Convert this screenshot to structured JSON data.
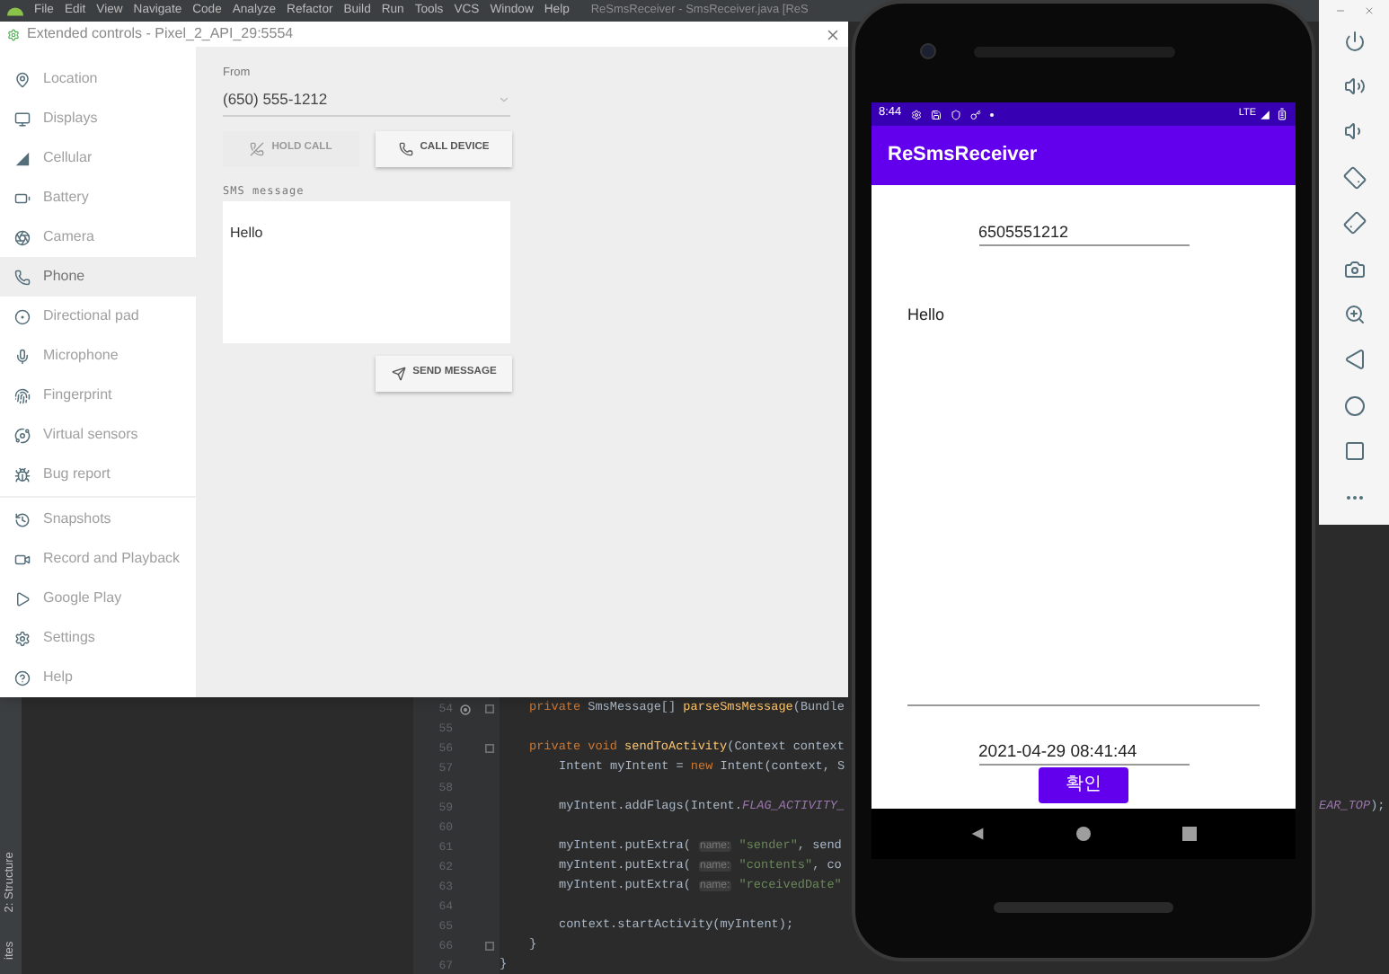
{
  "ide": {
    "menu": [
      "File",
      "Edit",
      "View",
      "Navigate",
      "Code",
      "Analyze",
      "Refactor",
      "Build",
      "Run",
      "Tools",
      "VCS",
      "Window",
      "Help"
    ],
    "title": "ReSmsReceiver - SmsReceiver.java [ReS",
    "tool_tabs": [
      "2: Structure",
      "ites"
    ],
    "code_lines": [
      {
        "children": [
          {
            "number": "54",
            "override": true,
            "fold": true,
            "segments": [
              {
                "kind": "keyword",
                "text": "private "
              },
              {
                "kind": "plain",
                "text": "SmsMessage[] "
              },
              {
                "kind": "method",
                "text": "parseSmsMessage"
              },
              {
                "kind": "plain",
                "text": "(Bundle"
              }
            ]
          },
          {
            "number": "55",
            "override": false,
            "fold": false
          },
          {
            "number": "56",
            "override": false,
            "fold": true,
            "segments": [
              {
                "kind": "keyword",
                "text": "private void "
              },
              {
                "kind": "method",
                "text": "sendToActivity"
              },
              {
                "kind": "plain",
                "text": "(Context context"
              }
            ],
            "children": [
              {
                "number": "57",
                "override": false,
                "fold": false,
                "segments": [
                  {
                    "kind": "plain",
                    "text": "Intent myIntent = "
                  },
                  {
                    "kind": "keyword",
                    "text": "new "
                  },
                  {
                    "kind": "plain",
                    "text": "Intent(context, S"
                  }
                ]
              },
              {
                "number": "58",
                "override": false,
                "fold": false
              },
              {
                "number": "59",
                "override": false,
                "fold": false,
                "segments": [
                  {
                    "kind": "plain",
                    "text": "myIntent.addFlags(Intent."
                  },
                  {
                    "kind": "constant",
                    "text": "FLAG_ACTIVITY_"
                  }
                ]
              },
              {
                "number": "60",
                "override": false,
                "fold": false
              },
              {
                "number": "61",
                "override": false,
                "fold": false,
                "segments": [
                  {
                    "kind": "plain",
                    "text": "myIntent.putExtra( "
                  },
                  {
                    "kind": "hint",
                    "text": "name:"
                  },
                  {
                    "kind": "string",
                    "text": " \"sender\""
                  },
                  {
                    "kind": "plain",
                    "text": ", send"
                  }
                ]
              },
              {
                "number": "62",
                "override": false,
                "fold": false,
                "segments": [
                  {
                    "kind": "plain",
                    "text": "myIntent.putExtra( "
                  },
                  {
                    "kind": "hint",
                    "text": "name:"
                  },
                  {
                    "kind": "string",
                    "text": " \"contents\""
                  },
                  {
                    "kind": "plain",
                    "text": ", co"
                  }
                ]
              },
              {
                "number": "63",
                "override": false,
                "fold": false,
                "segments": [
                  {
                    "kind": "plain",
                    "text": "myIntent.putExtra( "
                  },
                  {
                    "kind": "hint",
                    "text": "name:"
                  },
                  {
                    "kind": "string",
                    "text": " \"receivedDate\""
                  }
                ]
              },
              {
                "number": "64",
                "override": false,
                "fold": false
              },
              {
                "number": "65",
                "override": false,
                "fold": false,
                "segments": [
                  {
                    "kind": "plain",
                    "text": "context.startActivity(myIntent);"
                  }
                ]
              }
            ]
          },
          {
            "number": "66",
            "override": false,
            "fold": true,
            "segments": [
              {
                "kind": "plain",
                "text": "}"
              }
            ]
          }
        ]
      },
      {
        "number": "67",
        "override": false,
        "fold": false,
        "segments": [
          {
            "kind": "plain",
            "text": "}"
          }
        ]
      }
    ],
    "code_overflow": [
      {
        "kind": "constant",
        "text": "EAR_TOP"
      },
      {
        "kind": "plain",
        "text": ");"
      }
    ]
  },
  "extended_controls": {
    "title": "Extended controls - Pixel_2_API_29:5554",
    "nav_groups": [
      [
        {
          "label": "Location",
          "selected": false
        },
        {
          "label": "Displays",
          "selected": false
        },
        {
          "label": "Cellular",
          "selected": false
        },
        {
          "label": "Battery",
          "selected": false
        },
        {
          "label": "Camera",
          "selected": false
        },
        {
          "label": "Phone",
          "selected": true
        },
        {
          "label": "Directional pad",
          "selected": false
        },
        {
          "label": "Microphone",
          "selected": false
        },
        {
          "label": "Fingerprint",
          "selected": false
        },
        {
          "label": "Virtual sensors",
          "selected": false
        },
        {
          "label": "Bug report",
          "selected": false
        }
      ],
      [
        {
          "label": "Snapshots",
          "selected": false
        },
        {
          "label": "Record and Playback",
          "selected": false
        },
        {
          "label": "Google Play",
          "selected": false
        },
        {
          "label": "Settings",
          "selected": false
        },
        {
          "label": "Help",
          "selected": false
        }
      ]
    ],
    "from_label": "From",
    "from_value": "(650) 555-1212",
    "call_buttons": [
      {
        "label": "HOLD CALL",
        "disabled": true
      },
      {
        "label": "CALL DEVICE",
        "disabled": false
      }
    ],
    "sms_label": "SMS message",
    "sms_value": "Hello",
    "send_button": "SEND MESSAGE"
  },
  "phone": {
    "time": "8:44",
    "network": "LTE",
    "app_title": "ReSmsReceiver",
    "sender": "6505551212",
    "contents": "Hello",
    "received_date": "2021-04-29 08:41:44",
    "confirm_button": "확인"
  }
}
